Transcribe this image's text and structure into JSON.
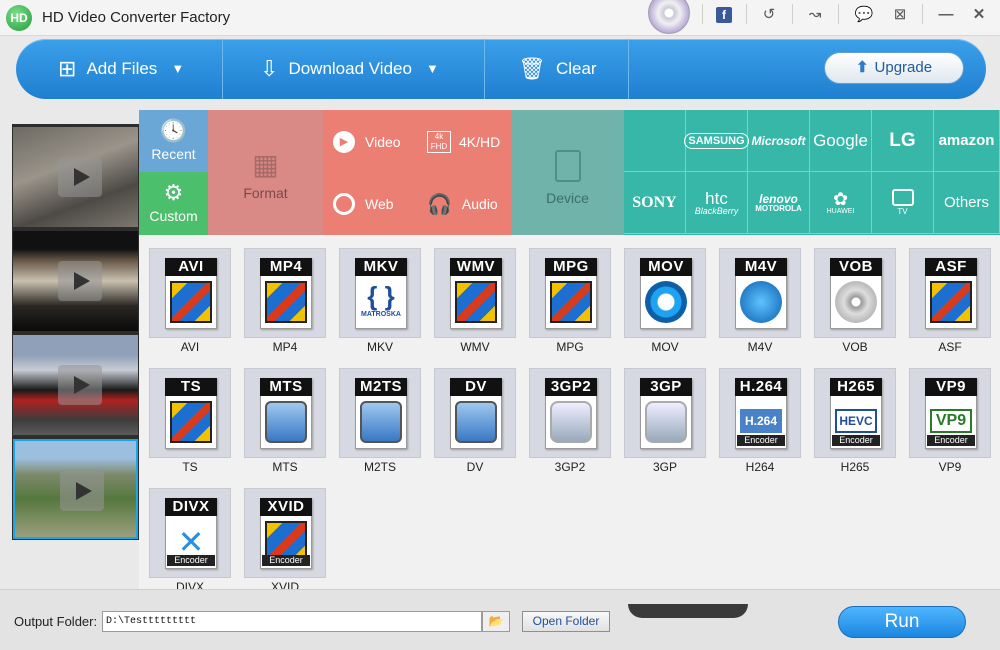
{
  "app": {
    "title": "HD Video Converter Factory",
    "logo_text": "HD"
  },
  "titlebar": {
    "icons": [
      "disc-icon",
      "facebook-icon",
      "refresh-icon",
      "skin-icon",
      "feedback-icon",
      "register-icon",
      "minimize-icon",
      "close-icon"
    ]
  },
  "toolbar": {
    "add_files": "Add Files",
    "download_video": "Download Video",
    "clear": "Clear",
    "upgrade": "Upgrade"
  },
  "categories": {
    "recent": "Recent",
    "custom": "Custom",
    "format": "Format",
    "video": "Video",
    "hd": "4K/HD",
    "hd_badge_top": "4k",
    "hd_badge_bottom": "FHD",
    "web": "Web",
    "audio": "Audio",
    "device": "Device"
  },
  "brands": {
    "row1": [
      "",
      "SAMSUNG",
      "Microsoft",
      "Google",
      "LG",
      "amazon"
    ],
    "row2": [
      "SONY",
      "htc",
      "lenovo",
      "HUAWEI",
      "TV",
      "Others"
    ],
    "htc_sub": "BlackBerry",
    "lenovo_sub": "MOTOROLA"
  },
  "formats": [
    {
      "badge": "AVI",
      "label": "AVI",
      "encoder": ""
    },
    {
      "badge": "MP4",
      "label": "MP4",
      "encoder": ""
    },
    {
      "badge": "MKV",
      "label": "MKV",
      "encoder": "",
      "sub": "MATROŠKA"
    },
    {
      "badge": "WMV",
      "label": "WMV",
      "encoder": ""
    },
    {
      "badge": "MPG",
      "label": "MPG",
      "encoder": ""
    },
    {
      "badge": "MOV",
      "label": "MOV",
      "encoder": ""
    },
    {
      "badge": "M4V",
      "label": "M4V",
      "encoder": ""
    },
    {
      "badge": "VOB",
      "label": "VOB",
      "encoder": ""
    },
    {
      "badge": "ASF",
      "label": "ASF",
      "encoder": ""
    },
    {
      "badge": "TS",
      "label": "TS",
      "encoder": ""
    },
    {
      "badge": "MTS",
      "label": "MTS",
      "encoder": ""
    },
    {
      "badge": "M2TS",
      "label": "M2TS",
      "encoder": ""
    },
    {
      "badge": "DV",
      "label": "DV",
      "encoder": ""
    },
    {
      "badge": "3GP2",
      "label": "3GP2",
      "encoder": ""
    },
    {
      "badge": "3GP",
      "label": "3GP",
      "encoder": ""
    },
    {
      "badge": "H.264",
      "label": "H264",
      "encoder": "Encoder",
      "inner": "H.264"
    },
    {
      "badge": "H265",
      "label": "H265",
      "encoder": "Encoder",
      "inner": "HEVC"
    },
    {
      "badge": "VP9",
      "label": "VP9",
      "encoder": "Encoder",
      "inner": "VP9"
    },
    {
      "badge": "DIVX",
      "label": "DIVX",
      "encoder": "Encoder"
    },
    {
      "badge": "XVID",
      "label": "XVID",
      "encoder": "Encoder"
    }
  ],
  "bottom": {
    "output_label": "Output Folder:",
    "output_path": "D:\\Testtttttttt",
    "open_folder": "Open Folder",
    "run": "Run"
  },
  "colors": {
    "recent_bg": "#6aa6d6",
    "custom_bg": "#4bbf6b",
    "format_bg": "#d98a86",
    "format_sub_bg": "#ec7f73",
    "device_bg": "#6fb3aa",
    "brand_bg": "#36b7a7",
    "toolbar": "#2a8ee0"
  }
}
